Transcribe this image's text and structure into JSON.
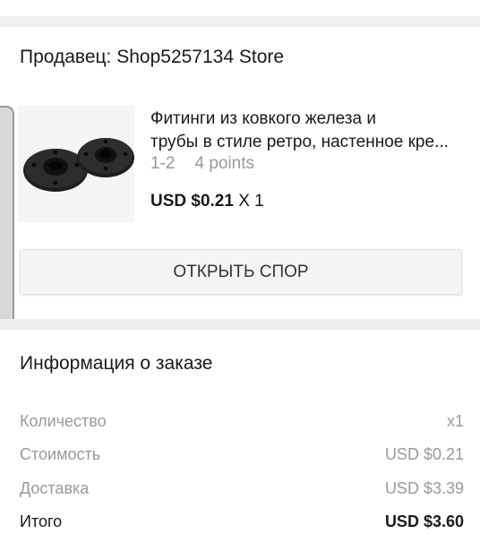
{
  "seller": {
    "title": "Продавец: Shop5257134 Store"
  },
  "product": {
    "name_line1": "Фитинги из ковкого железа и",
    "name_line2": "трубы в стиле ретро, настенное кре...",
    "variant": "1-2",
    "points": "4 points",
    "price": "USD $0.21",
    "quantity": "X 1",
    "image_icon": "flange-fitting-image"
  },
  "actions": {
    "open_dispute_label": "ОТКРЫТЬ СПОР"
  },
  "order_info": {
    "title": "Информация о заказе",
    "rows": [
      {
        "label": "Количество",
        "value": "x1"
      },
      {
        "label": "Стоимость",
        "value": "USD $0.21"
      },
      {
        "label": "Доставка",
        "value": "USD $3.39"
      },
      {
        "label": "Итого",
        "value": "USD $3.60"
      }
    ]
  },
  "colors": {
    "background": "#ffffff",
    "separator": "#eeeeee",
    "muted_text": "#9a9a9a",
    "primary_text": "#1a1a1a",
    "button_bg": "#f5f5f5"
  }
}
